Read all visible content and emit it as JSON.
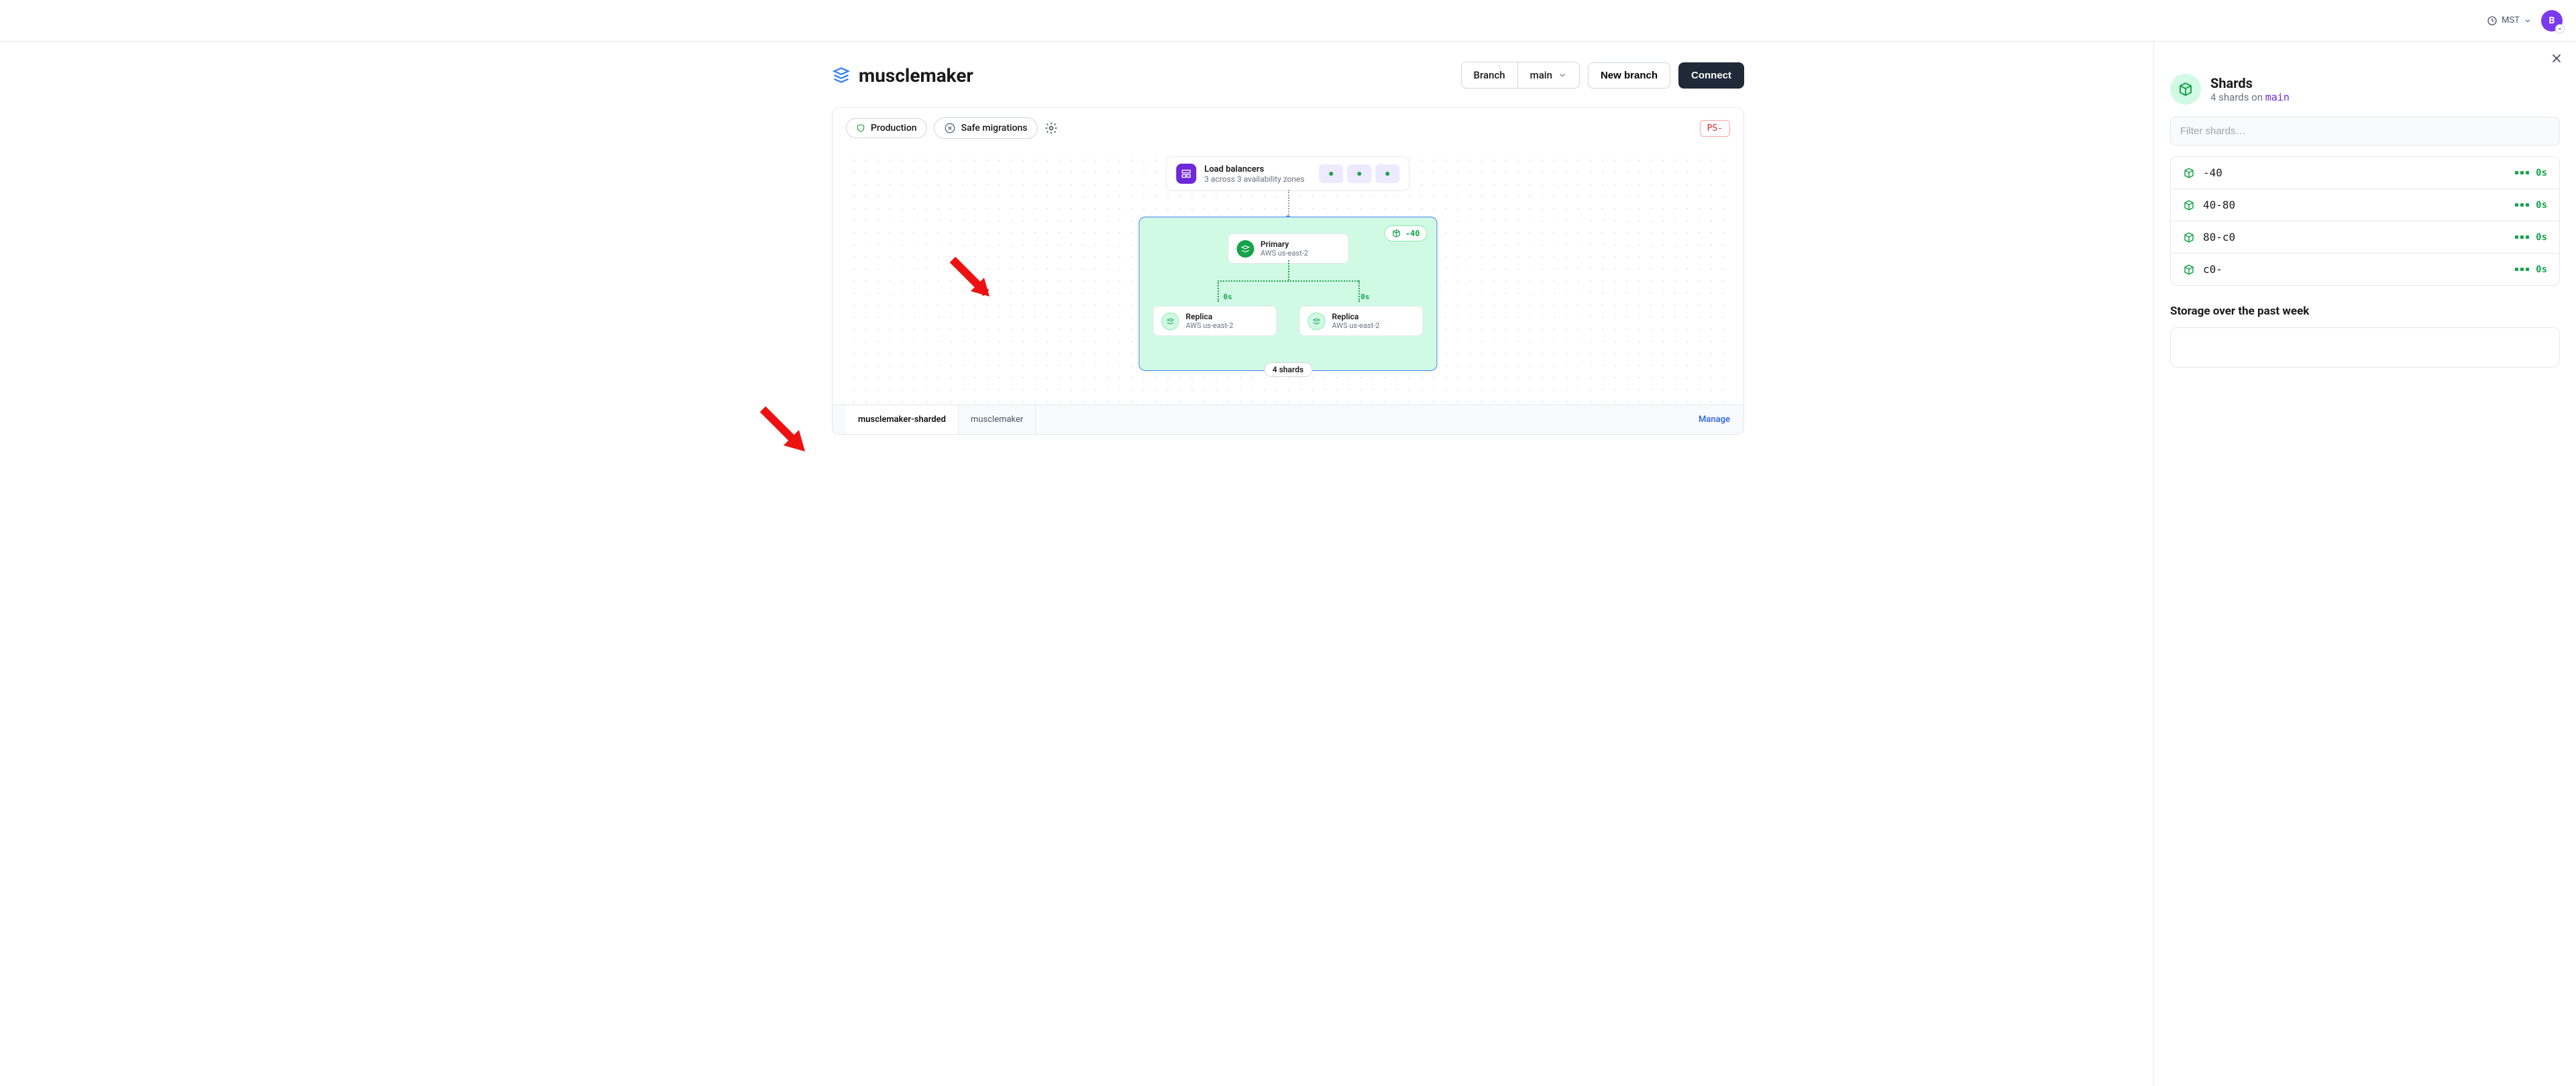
{
  "header": {
    "timezone": "MST",
    "avatar_initial": "B"
  },
  "page": {
    "title": "musclemaker",
    "branch_label": "Branch",
    "branch_value": "main",
    "new_branch": "New branch",
    "connect": "Connect"
  },
  "card": {
    "chip_production": "Production",
    "chip_safe": "Safe migrations",
    "ps_label": "PS-",
    "lb": {
      "title": "Load balancers",
      "subtitle": "3 across 3 availability zones"
    },
    "shard_tag": "-40",
    "primary": {
      "title": "Primary",
      "region": "AWS us-east-2"
    },
    "replica1": {
      "title": "Replica",
      "region": "AWS us-east-2",
      "latency": "0s"
    },
    "replica2": {
      "title": "Replica",
      "region": "AWS us-east-2",
      "latency": "0s"
    },
    "shard_count": "4 shards",
    "keyspace_tabs": [
      "musclemaker-sharded",
      "musclemaker"
    ],
    "manage": "Manage"
  },
  "panel": {
    "title": "Shards",
    "sub_prefix": "4 shards on ",
    "sub_branch": "main",
    "search_placeholder": "Filter shards…",
    "shards": [
      {
        "name": "-40",
        "latency": "0s"
      },
      {
        "name": "40-80",
        "latency": "0s"
      },
      {
        "name": "80-c0",
        "latency": "0s"
      },
      {
        "name": "c0-",
        "latency": "0s"
      }
    ],
    "storage_title": "Storage over the past week"
  }
}
